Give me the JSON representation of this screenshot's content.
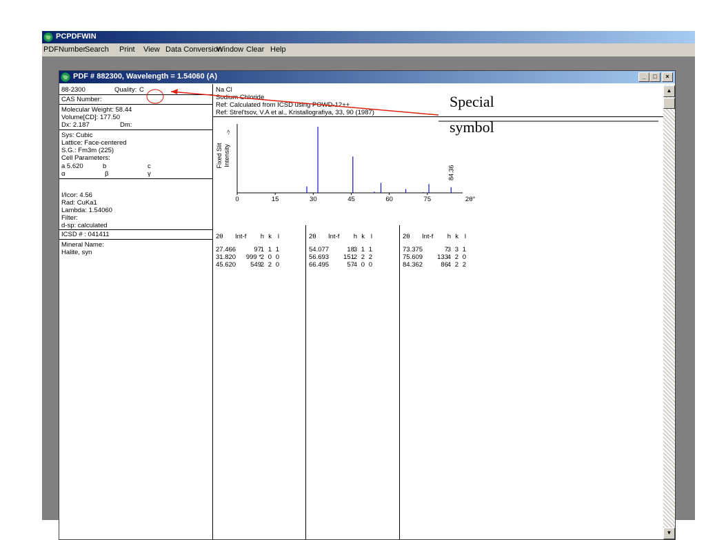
{
  "app": {
    "title": "PCPDFWIN",
    "menu": [
      "PDFNumber",
      "Search",
      "Print",
      "View",
      "Data Conversion",
      "Window",
      "Clear",
      "Help"
    ]
  },
  "window": {
    "title": "PDF # 882300, Wavelength = 1.54060  (A)",
    "buttons": {
      "minimize": "_",
      "restore": "□",
      "close": "×"
    }
  },
  "left": {
    "pdf_number": "88-2300",
    "quality_label": "Quality:",
    "quality_value": "C",
    "cas": "CAS Number:",
    "mol_weight": "Molecular Weight:  58.44",
    "volume": "Volume[CD]:  177.50",
    "dx": "Dx: 2.187",
    "dm": "Dm:",
    "sys": "Sys: Cubic",
    "lattice": "Lattice: Face-centered",
    "sg": "S.G.: Fm3m (225)",
    "cell": "Cell Parameters:",
    "a": "a  5.620",
    "b": "b",
    "c": "c",
    "alpha": "α",
    "beta": "β",
    "gamma": "γ",
    "icor": "I/Icor:  4.56",
    "rad": "Rad: CuKa1",
    "lambda": "Lambda: 1.54060",
    "filter": "Filter:",
    "dsp": "d-sp: calculated",
    "icsd": "ICSD # : 041411",
    "mineral_label": "Mineral Name:",
    "mineral": "Halite, syn"
  },
  "right": {
    "formula": "Na Cl",
    "name": "Sodium Chloride",
    "ref1": "Ref:  Calculated from ICSD using POWD-12++",
    "ref2": "Ref: Strel'tsov, V.A et al., Kristallografiya, 33, 90 (1987)"
  },
  "chart_data": {
    "type": "bar",
    "ylabel": "Fixed  Slit\nIntensity",
    "y_marker": "->",
    "xlabel": "2θ°",
    "xlim": [
      0,
      90
    ],
    "ylim": [
      0,
      999
    ],
    "xticks": [
      "0",
      "15",
      "30",
      "45",
      "60",
      "75"
    ],
    "peak_label": "84.36",
    "peaks": [
      {
        "x": 27.466,
        "y": 97
      },
      {
        "x": 31.82,
        "y": 999
      },
      {
        "x": 45.62,
        "y": 549
      },
      {
        "x": 54.077,
        "y": 18
      },
      {
        "x": 56.693,
        "y": 151
      },
      {
        "x": 66.495,
        "y": 57
      },
      {
        "x": 73.375,
        "y": 7
      },
      {
        "x": 75.609,
        "y": 133
      },
      {
        "x": 84.362,
        "y": 86
      }
    ]
  },
  "table": {
    "headers": [
      "2θ",
      "Int-f",
      "h",
      "k",
      "l"
    ],
    "columns": [
      [
        [
          "27.466",
          "97",
          "1",
          "1",
          "1"
        ],
        [
          "31.820",
          "999 *",
          "2",
          "0",
          "0"
        ],
        [
          "45.620",
          "549",
          "2",
          "2",
          "0"
        ]
      ],
      [
        [
          "54.077",
          "18",
          "3",
          "1",
          "1"
        ],
        [
          "56.693",
          "151",
          "2",
          "2",
          "2"
        ],
        [
          "66.495",
          "57",
          "4",
          "0",
          "0"
        ]
      ],
      [
        [
          "73.375",
          "7",
          "3",
          "3",
          "1"
        ],
        [
          "75.609",
          "133",
          "4",
          "2",
          "0"
        ],
        [
          "84.362",
          "86",
          "4",
          "2",
          "2"
        ]
      ]
    ]
  },
  "annotation": {
    "line1": "Special",
    "line2": "symbol",
    "color": "#e02010"
  }
}
